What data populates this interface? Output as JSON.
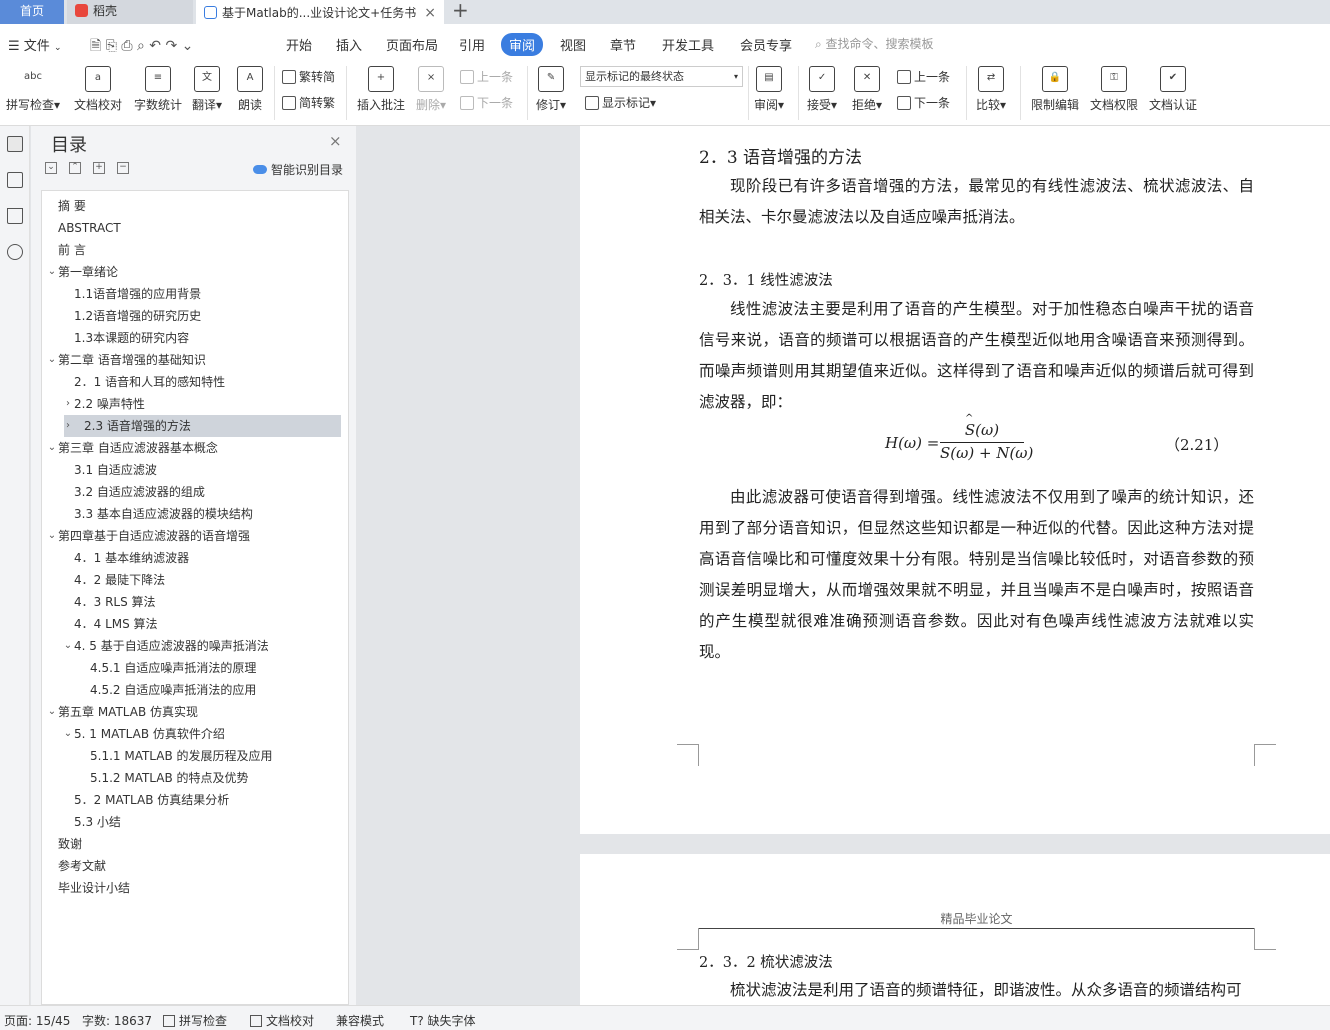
{
  "tabs": {
    "home": "首页",
    "daoke": "稻壳",
    "doc": "基于Matlab的...业设计论文+任务书",
    "close": "×",
    "new": "+"
  },
  "menu": {
    "file": "文件",
    "items": [
      "开始",
      "插入",
      "页面布局",
      "引用",
      "审阅",
      "视图",
      "章节",
      "开发工具",
      "会员专享"
    ],
    "search": "查找命令、搜索模板"
  },
  "ribbon": {
    "spell": "拼写检查",
    "proof": "文档校对",
    "count": "字数统计",
    "translate": "翻译",
    "read": "朗读",
    "trad": "繁转简",
    "simp": "简转繁",
    "insert_comment": "插入批注",
    "delete": "删除",
    "prev": "上一条",
    "next": "下一条",
    "revise": "修订",
    "mark_state": "显示标记的最终状态",
    "show_marks": "显示标记",
    "review": "审阅",
    "accept": "接受",
    "reject": "拒绝",
    "prev2": "上一条",
    "next2": "下一条",
    "compare": "比较",
    "restrict": "限制编辑",
    "rights": "文档权限",
    "cert": "文档认证"
  },
  "nav": {
    "title": "目录",
    "smart": "智能识别目录",
    "items": [
      {
        "text": "摘  要",
        "caret": ""
      },
      {
        "text": "ABSTRACT",
        "caret": ""
      },
      {
        "text": "前  言",
        "caret": ""
      },
      {
        "text": "第一章绪论",
        "caret": "⌄"
      },
      {
        "text": "1.1语音增强的应用背景",
        "caret": ""
      },
      {
        "text": "1.2语音增强的研究历史",
        "caret": ""
      },
      {
        "text": "1.3本课题的研究内容",
        "caret": ""
      },
      {
        "text": "第二章  语音增强的基础知识",
        "caret": "⌄"
      },
      {
        "text": "2．1  语音和人耳的感知特性",
        "caret": ""
      },
      {
        "text": "2.2  噪声特性",
        "caret": "›"
      },
      {
        "text": "2.3    语音增强的方法",
        "caret": "›"
      },
      {
        "text": "第三章    自适应滤波器基本概念",
        "caret": "⌄"
      },
      {
        "text": "3.1 自适应滤波",
        "caret": ""
      },
      {
        "text": "3.2 自适应滤波器的组成",
        "caret": ""
      },
      {
        "text": "3.3 基本自适应滤波器的模块结构",
        "caret": ""
      },
      {
        "text": "第四章基于自适应滤波器的语音增强",
        "caret": "⌄"
      },
      {
        "text": "4．1      基本维纳滤波器",
        "caret": ""
      },
      {
        "text": "4．2 最陡下降法",
        "caret": ""
      },
      {
        "text": "4．3    RLS 算法",
        "caret": ""
      },
      {
        "text": "4．4    LMS 算法",
        "caret": ""
      },
      {
        "text": "4. 5  基于自适应滤波器的噪声抵消法",
        "caret": "⌄"
      },
      {
        "text": "4.5.1 自适应噪声抵消法的原理",
        "caret": ""
      },
      {
        "text": "4.5.2 自适应噪声抵消法的应用",
        "caret": ""
      },
      {
        "text": "第五章  MATLAB 仿真实现",
        "caret": "⌄"
      },
      {
        "text": "5. 1  MATLAB 仿真软件介绍",
        "caret": "⌄"
      },
      {
        "text": "5.1.1 MATLAB 的发展历程及应用",
        "caret": ""
      },
      {
        "text": "5.1.2    MATLAB 的特点及优势",
        "caret": ""
      },
      {
        "text": "5．2    MATLAB 仿真结果分析",
        "caret": ""
      },
      {
        "text": "5.3 小结",
        "caret": ""
      },
      {
        "text": "致谢",
        "caret": ""
      },
      {
        "text": "参考文献",
        "caret": ""
      },
      {
        "text": "毕业设计小结",
        "caret": ""
      }
    ]
  },
  "doc": {
    "h_23": "2．3    语音增强的方法",
    "p1": "现阶段已有许多语音增强的方法，最常见的有线性滤波法、梳状滤波法、自相关法、卡尔曼滤波法以及自适应噪声抵消法。",
    "h_231": "2．3．1  线性滤波法",
    "p2": "线性滤波法主要是利用了语音的产生模型。对于加性稳态白噪声干扰的语音信号来说，语音的频谱可以根据语音的产生模型近似地用含噪语音来预测得到。而噪声频谱则用其期望值来近似。这样得到了语音和噪声近似的频谱后就可得到滤波器，即：",
    "eq_lhs": "H(ω) =",
    "eq_num": "S(ω)",
    "eq_den": "S(ω) + N(ω)",
    "eq_label": "（2.21）",
    "p3": "由此滤波器可使语音得到增强。线性滤波法不仅用到了噪声的统计知识，还用到了部分语音知识，但显然这些知识都是一种近似的代替。因此这种方法对提高语音信噪比和可懂度效果十分有限。特别是当信噪比较低时，对语音参数的预测误差明显增大，从而增强效果就不明显，并且当噪声不是白噪声时，按照语音的产生模型就很难准确预测语音参数。因此对有色噪声线性滤波方法就难以实现。",
    "header2": "精品毕业论文",
    "h_232": "2．3．2  梳状滤波法",
    "p4": "梳状滤波法是利用了语音的频谱特征，即谐波性。从众多语音的频谱结构可"
  },
  "status": {
    "page": "页面: 15/45",
    "words": "字数: 18637",
    "spell": "拼写检查",
    "proof": "文档校对",
    "compat": "兼容模式",
    "font": "缺失字体"
  }
}
